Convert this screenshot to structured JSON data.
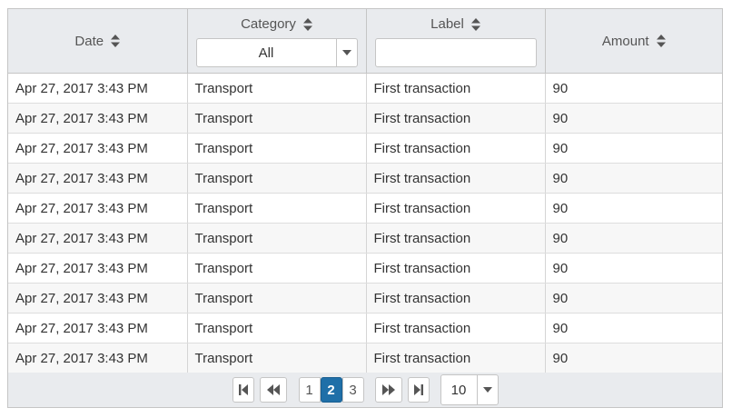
{
  "columns": {
    "date": "Date",
    "category": "Category",
    "label": "Label",
    "amount": "Amount"
  },
  "filters": {
    "category_value": "All",
    "label_value": ""
  },
  "rows": [
    {
      "date": "Apr 27, 2017 3:43 PM",
      "category": "Transport",
      "label": "First transaction",
      "amount": "90"
    },
    {
      "date": "Apr 27, 2017 3:43 PM",
      "category": "Transport",
      "label": "First transaction",
      "amount": "90"
    },
    {
      "date": "Apr 27, 2017 3:43 PM",
      "category": "Transport",
      "label": "First transaction",
      "amount": "90"
    },
    {
      "date": "Apr 27, 2017 3:43 PM",
      "category": "Transport",
      "label": "First transaction",
      "amount": "90"
    },
    {
      "date": "Apr 27, 2017 3:43 PM",
      "category": "Transport",
      "label": "First transaction",
      "amount": "90"
    },
    {
      "date": "Apr 27, 2017 3:43 PM",
      "category": "Transport",
      "label": "First transaction",
      "amount": "90"
    },
    {
      "date": "Apr 27, 2017 3:43 PM",
      "category": "Transport",
      "label": "First transaction",
      "amount": "90"
    },
    {
      "date": "Apr 27, 2017 3:43 PM",
      "category": "Transport",
      "label": "First transaction",
      "amount": "90"
    },
    {
      "date": "Apr 27, 2017 3:43 PM",
      "category": "Transport",
      "label": "First transaction",
      "amount": "90"
    },
    {
      "date": "Apr 27, 2017 3:43 PM",
      "category": "Transport",
      "label": "First transaction",
      "amount": "90"
    }
  ],
  "pager": {
    "pages": [
      "1",
      "2",
      "3"
    ],
    "current_page": "2",
    "page_size": "10"
  },
  "icons": {
    "sort": "sort-icon",
    "dropdown": "chevron-down-icon",
    "first": "first-page-icon",
    "prev": "previous-page-icon",
    "next": "next-page-icon",
    "last": "last-page-icon"
  },
  "colors": {
    "header_bg": "#e9ebee",
    "active_page": "#1f6fa8",
    "zebra": "#f7f7f7",
    "border": "#c5c5c5"
  }
}
